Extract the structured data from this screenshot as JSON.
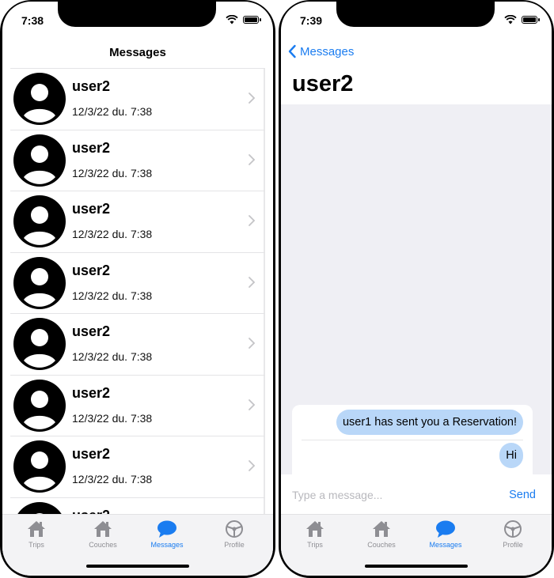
{
  "status_bar": {
    "left_time": "7:38",
    "right_time": "7:39"
  },
  "left_screen": {
    "nav_title": "Messages",
    "conversations": [
      {
        "name": "user2",
        "date": "12/3/22 du. 7:38"
      },
      {
        "name": "user2",
        "date": "12/3/22 du. 7:38"
      },
      {
        "name": "user2",
        "date": "12/3/22 du. 7:38"
      },
      {
        "name": "user2",
        "date": "12/3/22 du. 7:38"
      },
      {
        "name": "user2",
        "date": "12/3/22 du. 7:38"
      },
      {
        "name": "user2",
        "date": "12/3/22 du. 7:38"
      },
      {
        "name": "user2",
        "date": "12/3/22 du. 7:38"
      },
      {
        "name": "user2",
        "date": ""
      }
    ]
  },
  "right_screen": {
    "back_label": "Messages",
    "title": "user2",
    "messages": [
      {
        "text": "user1 has sent you a Reservation!"
      },
      {
        "text": "Hi"
      }
    ],
    "input_placeholder": "Type a message...",
    "send_label": "Send"
  },
  "tabbar": {
    "tabs": [
      {
        "label": "Trips",
        "icon": "house-icon"
      },
      {
        "label": "Couches",
        "icon": "house-icon"
      },
      {
        "label": "Messages",
        "icon": "chat-bubble-icon",
        "active": true
      },
      {
        "label": "Profile",
        "icon": "steering-wheel-icon"
      }
    ]
  },
  "colors": {
    "accent": "#1a7cf0",
    "bubble": "#b9d7f8",
    "chat_bg": "#efeff4",
    "inactive_tab": "#8e8e93"
  }
}
